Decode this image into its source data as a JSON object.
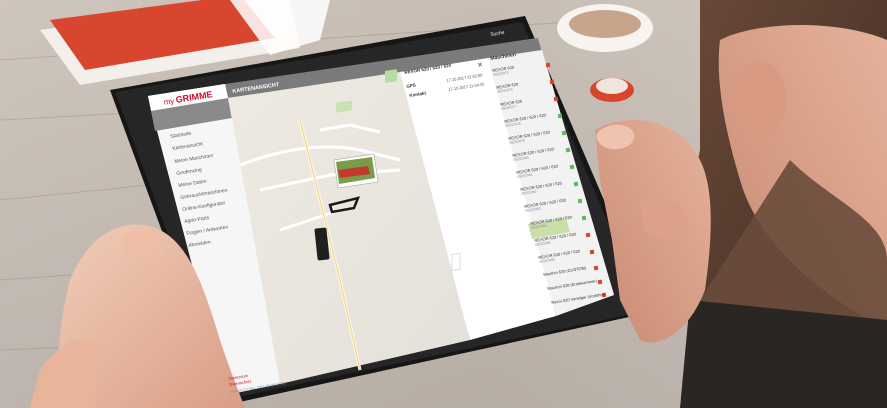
{
  "app": {
    "logo_prefix": "my",
    "logo_brand": "GRIMME",
    "view_title": "KARTENANSICHT",
    "search_placeholder": "Suche"
  },
  "sidebar": {
    "items": [
      {
        "label": "Startseite",
        "icon": "home-icon"
      },
      {
        "label": "Kartenansicht",
        "icon": "map-pin-icon"
      },
      {
        "label": "Meine Maschinen",
        "icon": "tractor-icon"
      },
      {
        "label": "Geofencing",
        "icon": "fence-icon"
      },
      {
        "label": "Meine Daten",
        "icon": "user-icon"
      },
      {
        "label": "Gebrauchtmaschinen",
        "icon": "tag-icon"
      },
      {
        "label": "Online-Konfigurator",
        "icon": "gear-icon"
      },
      {
        "label": "Agrio-Parts",
        "icon": "wrench-icon"
      },
      {
        "label": "Fragen / Antworten",
        "icon": "question-icon"
      },
      {
        "label": "Abmelden",
        "icon": "logout-icon"
      }
    ],
    "footer_links": [
      "Impressum",
      "Datenschutz"
    ],
    "footer_version": "Version 1.0 (dev, 2017-09-20 12:34)"
  },
  "detail": {
    "title": "REXOR 620 / 620 / 620",
    "rows": [
      {
        "label": "GPS",
        "value": "17.10.2017 11:52:08"
      },
      {
        "label": "Kontakt",
        "value": "17.10.2017 11:54:35"
      }
    ]
  },
  "machines": {
    "header": "Maschinen",
    "list": [
      {
        "name": "REXOR 620",
        "id": "09202075",
        "status": "red"
      },
      {
        "name": "REXOR 620",
        "id": "09202076",
        "status": "red"
      },
      {
        "name": "REXOR 620",
        "id": "09202077",
        "status": "red"
      },
      {
        "name": "REXOR 620 / 620 / 620",
        "id": "09202078",
        "status": "green"
      },
      {
        "name": "REXOR 620 / 620 / 620",
        "id": "09202079",
        "status": "green"
      },
      {
        "name": "REXOR 620 / 620 / 620",
        "id": "09202080",
        "status": "green"
      },
      {
        "name": "REXOR 620 / 620 / 620",
        "id": "09202081",
        "status": "green"
      },
      {
        "name": "REXOR 620 / 620 / 620",
        "id": "09202082",
        "status": "green"
      },
      {
        "name": "REXOR 620 / 620 / 620",
        "id": "09202083",
        "status": "green"
      },
      {
        "name": "REXOR 620 / 620 / 620",
        "id": "09202084",
        "status": "green"
      },
      {
        "name": "REXOR 620 / 620 / 620",
        "id": "09202085",
        "status": "red"
      },
      {
        "name": "REXOR 620 / 620 / 620",
        "id": "09202086",
        "status": "red"
      },
      {
        "name": "Maxtron 620 (CUSTOM)",
        "id": "",
        "status": "red"
      },
      {
        "name": "Maxtron 620 (Erntekammer)",
        "id": "",
        "status": "red"
      },
      {
        "name": "Rexor 620 Verfolger (Vorführ.)",
        "id": "",
        "status": "red"
      }
    ]
  },
  "colors": {
    "brand_red": "#c8102e",
    "status_green": "#5cb85c",
    "status_red": "#d9412b",
    "header_grey": "#7b7b7b"
  }
}
